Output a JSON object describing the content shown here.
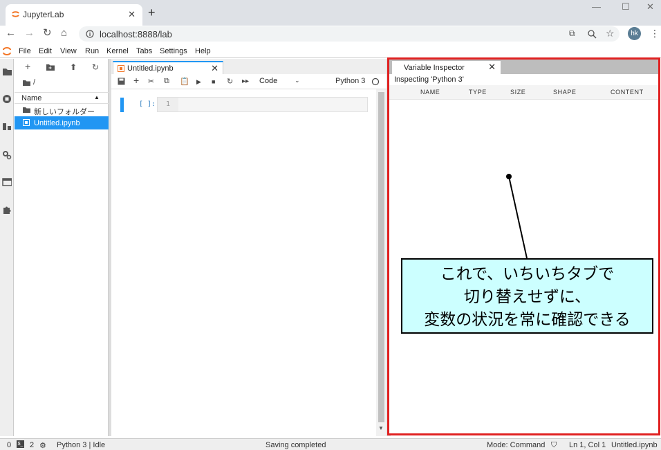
{
  "browser": {
    "tab_title": "JupyterLab",
    "url": "localhost:8888/lab",
    "profile_initials": "hk",
    "accent": "#f37626"
  },
  "menubar": [
    "File",
    "Edit",
    "View",
    "Run",
    "Kernel",
    "Tabs",
    "Settings",
    "Help"
  ],
  "file_browser": {
    "breadcrumb": "/",
    "column_name": "Name",
    "items": [
      {
        "name": "新しいフォルダー",
        "type": "folder",
        "selected": false
      },
      {
        "name": "Untitled.ipynb",
        "type": "notebook",
        "selected": true
      }
    ]
  },
  "notebook": {
    "tab_title": "Untitled.ipynb",
    "cell_type": "Code",
    "kernel_name": "Python 3",
    "cell_prompt": "[ ]:",
    "line_number": "1"
  },
  "inspector": {
    "tab_title": "Variable Inspector",
    "subtitle": "Inspecting 'Python 3'",
    "columns": [
      "NAME",
      "TYPE",
      "SIZE",
      "SHAPE",
      "CONTENT"
    ]
  },
  "callout": {
    "lines": [
      "これで、いちいちタブで",
      "切り替えせずに、",
      "変数の状況を常に確認できる"
    ],
    "bg": "#ccffff",
    "frame_color": "#e02020"
  },
  "status": {
    "count_a": "0",
    "count_b": "2",
    "kernel_state": "Python 3 | Idle",
    "message": "Saving completed",
    "mode": "Mode: Command",
    "cursor": "Ln 1, Col 1",
    "file": "Untitled.ipynb"
  }
}
